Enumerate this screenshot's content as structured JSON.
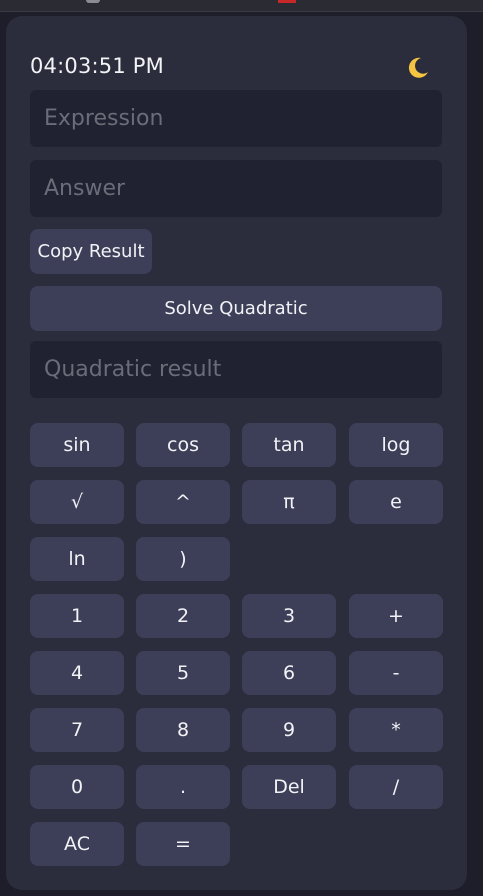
{
  "header": {
    "time": "04:03:51 PM",
    "theme_icon": "crescent-moon-icon"
  },
  "inputs": {
    "expression_placeholder": "Expression",
    "answer_placeholder": "Answer",
    "quadratic_placeholder": "Quadratic result"
  },
  "actions": {
    "copy_label": "Copy Result",
    "solve_label": "Solve Quadratic"
  },
  "keypad": {
    "rows": [
      [
        "sin",
        "cos",
        "tan",
        "log"
      ],
      [
        "√",
        "^",
        "π",
        "e"
      ],
      [
        "ln",
        ")"
      ],
      [
        "1",
        "2",
        "3",
        "+"
      ],
      [
        "4",
        "5",
        "6",
        "-"
      ],
      [
        "7",
        "8",
        "9",
        "*"
      ],
      [
        "0",
        ".",
        "Del",
        "/"
      ],
      [
        "AC",
        "="
      ]
    ]
  },
  "colors": {
    "background": "#1d1e2a",
    "card": "#2b2d3d",
    "field": "#202231",
    "button": "#3d3f58",
    "text": "#f2f2f6",
    "placeholder": "#6a6c78",
    "moon": "#f5c542"
  }
}
